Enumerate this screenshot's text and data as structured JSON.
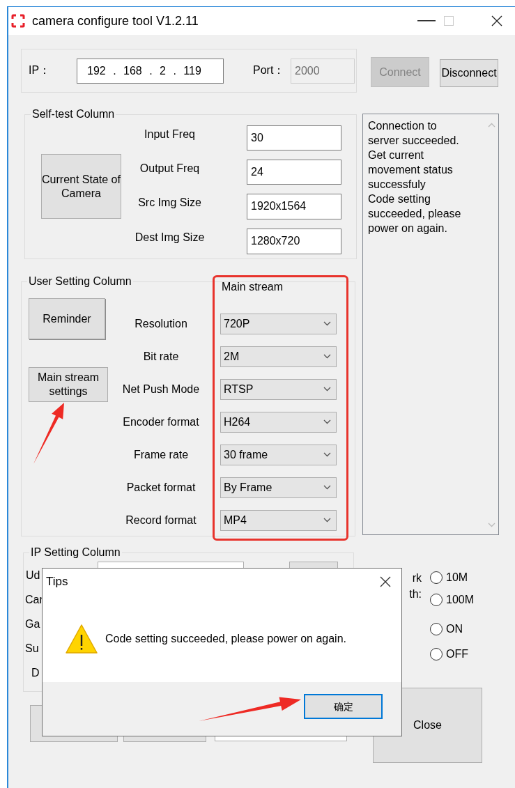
{
  "window": {
    "title": "camera configure tool V1.2.11"
  },
  "connection": {
    "ip_label": "IP：",
    "ip_address": "192 . 168 . 2 . 119",
    "port_label": "Port：",
    "port": "2000",
    "port_disabled": true,
    "buttons": [
      {
        "label": "Connect",
        "disabled": true
      },
      {
        "label": "Disconnect",
        "disabled": false
      }
    ]
  },
  "self_test": {
    "title": "Self-test Column",
    "button": "Current State of Camera",
    "fields": [
      {
        "label": "Input Freq",
        "value": "30"
      },
      {
        "label": "Output Freq",
        "value": "24"
      },
      {
        "label": "Src Img Size",
        "value": "1920x1564"
      },
      {
        "label": "Dest Img Size",
        "value": "1280x720"
      }
    ]
  },
  "user_settings": {
    "title": "User Setting Column",
    "buttons": [
      "Reminder",
      "Main stream settings"
    ],
    "stream_title": "Main stream",
    "highlighted": true,
    "rows": [
      {
        "label": "Resolution",
        "value": "720P"
      },
      {
        "label": "Bit rate",
        "value": "2M"
      },
      {
        "label": "Net Push Mode",
        "value": "RTSP"
      },
      {
        "label": "Encoder format",
        "value": "H264"
      },
      {
        "label": "Frame rate",
        "value": "30 frame"
      },
      {
        "label": "Packet format",
        "value": "By Frame"
      },
      {
        "label": "Record format",
        "value": "MP4"
      }
    ]
  },
  "log": {
    "lines": [
      "Connection to server succeeded.",
      "Get current movement status successfuly",
      "Code setting succeeded, please power on again."
    ]
  },
  "ip_settings": {
    "title": "IP Setting Column",
    "labels": [
      "Ud",
      "Car",
      "Ga",
      "Su",
      "D"
    ]
  },
  "network": {
    "labels": [
      "rk",
      "th:"
    ],
    "radio_groups": [
      {
        "options": [
          {
            "label": "10M",
            "selected": false
          },
          {
            "label": "100M",
            "selected": false
          }
        ]
      },
      {
        "options": [
          {
            "label": "ON",
            "selected": false
          },
          {
            "label": "OFF",
            "selected": false
          }
        ]
      }
    ]
  },
  "close_button": "Close",
  "dialog": {
    "title": "Tips",
    "message": "Code setting succeeded, please power on again.",
    "button": "确定"
  }
}
